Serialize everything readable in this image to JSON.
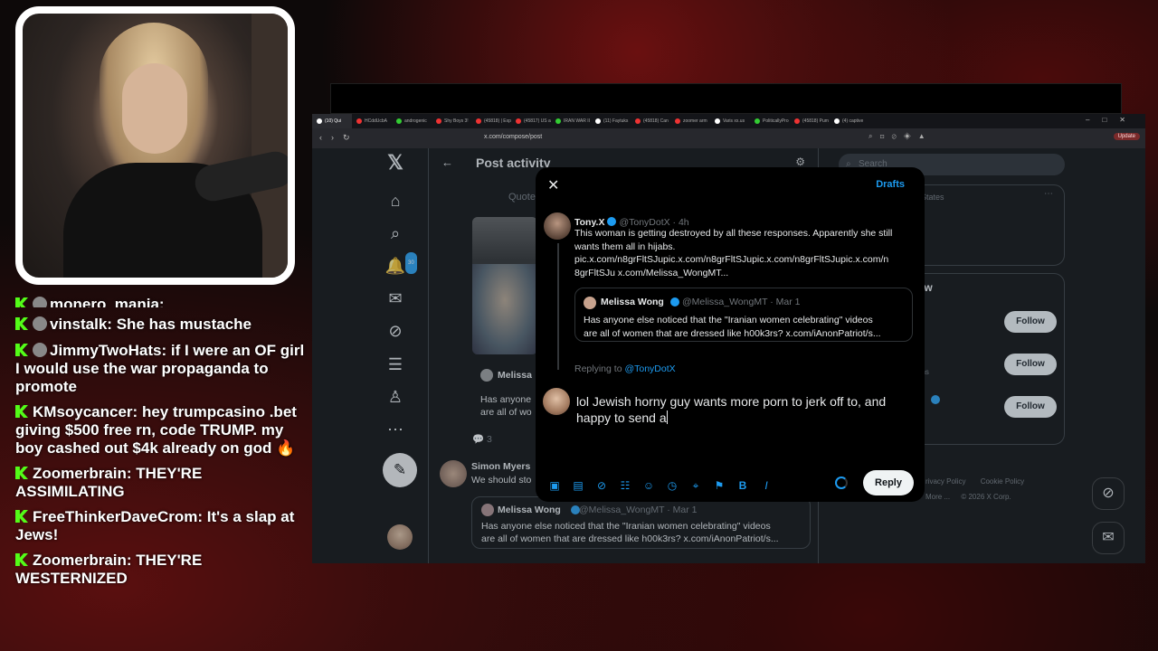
{
  "chat": [
    {
      "user": "monero_mania:",
      "text": ""
    },
    {
      "user": "vinstalk:",
      "text": "She has mustache"
    },
    {
      "user": "JimmyTwoHats:",
      "text": "if I were an OF girl I would use the war propaganda to promote"
    },
    {
      "user": "KMsoycancer:",
      "text": "hey trumpcasino .bet giving $500 free rn, code TRUMP. my boy cashed out $4k already on god 🔥"
    },
    {
      "user": "Zoomerbrain:",
      "text": "THEY'RE ASSIMILATING"
    },
    {
      "user": "FreeThinkerDaveCrom:",
      "text": "It's a slap at Jews!"
    },
    {
      "user": "Zoomerbrain:",
      "text": "THEY'RE WESTERNIZED"
    }
  ],
  "browser": {
    "url": "x.com/compose/post",
    "update_label": "Update",
    "tabs": [
      "(10) Qui",
      "HCddUcbA",
      "androgenic",
      "Shy Boys 3!",
      "(45818) | Exp",
      "(45817) US ar",
      "IRAN WAR II",
      "(11) Faytuks",
      "(45818) Can",
      "zoomer arm",
      "Varis xx.us",
      "PoliticallyPro",
      "(45818) Pum",
      "(4) captive"
    ]
  },
  "x": {
    "page_title": "Post activity",
    "quotes_tab": "Quotes",
    "notif_count": "30",
    "search_placeholder": "Search",
    "trend_snippet": "States",
    "who_to_follow": "ow",
    "follow_label": "Follow",
    "right_snips": [
      "ens",
      "ll"
    ],
    "footer": [
      "rivacy Policy",
      "Cookie Policy",
      "More ...",
      "© 2026 X Corp."
    ],
    "feed": {
      "melissa_stub": "Melissa",
      "stub_lines": [
        "Has anyone",
        "are all of wo"
      ],
      "reply_count": "3",
      "simon_name": "Simon Myers",
      "simon_text": "We should sto",
      "quoted_name": "Melissa Wong",
      "quoted_handle": "@Melissa_WongMT · Mar 1",
      "quoted_text1": "Has anyone else noticed that the \"Iranian women celebrating\" videos",
      "quoted_text2": "are all of women that are dressed like h00k3rs? x.com/iAnonPatriot/s..."
    }
  },
  "modal": {
    "drafts": "Drafts",
    "author_name": "Tony.X",
    "author_handle": "@TonyDotX · 4h",
    "post_text": [
      "This woman is getting destroyed by all these responses. Apparently she still",
      "wants them all in hijabs.",
      "pic.x.com/n8grFltSJupic.x.com/n8grFltSJupic.x.com/n8grFltSJupic.x.com/n",
      "8grFltSJu x.com/Melissa_WongMT..."
    ],
    "quote_name": "Melissa Wong",
    "quote_handle": "@Melissa_WongMT · Mar 1",
    "quote_text": [
      "Has anyone else noticed that the \"Iranian women celebrating\" videos",
      "are all of women that are dressed like h00k3rs? x.com/iAnonPatriot/s..."
    ],
    "replying_prefix": "Replying to ",
    "replying_to": "@TonyDotX",
    "draft_text": [
      "lol Jewish horny guy wants more porn to jerk off to, and",
      "happy to send a"
    ],
    "reply_button": "Reply"
  }
}
